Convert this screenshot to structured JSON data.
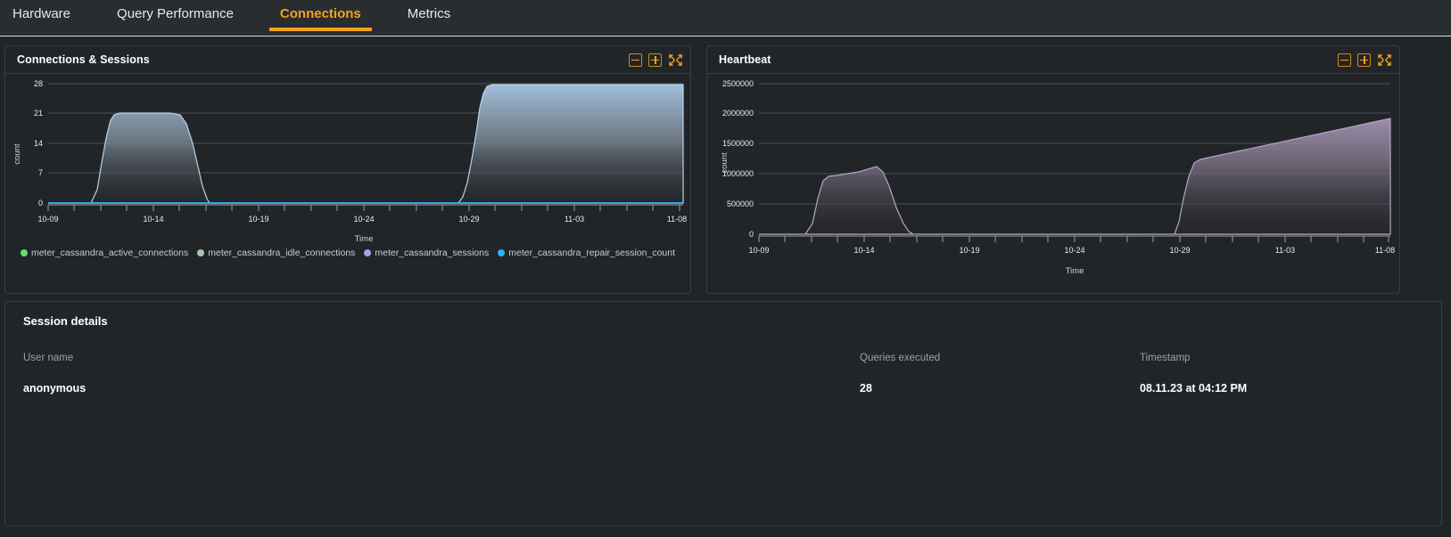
{
  "tabs": [
    {
      "label": "Hardware",
      "active": false
    },
    {
      "label": "Query Performance",
      "active": false
    },
    {
      "label": "Connections",
      "active": true
    },
    {
      "label": "Metrics",
      "active": false
    }
  ],
  "panels": {
    "connections": {
      "title": "Connections & Sessions",
      "tools": {
        "collapse_label": "−",
        "expand_label": "+",
        "fullscreen_label": "fullscreen"
      }
    },
    "heartbeat": {
      "title": "Heartbeat",
      "tools": {
        "collapse_label": "−",
        "expand_label": "+",
        "fullscreen_label": "fullscreen"
      }
    }
  },
  "colors": {
    "accent": "#f5a11b",
    "panel_bg": "#222528",
    "page_bg": "#222528",
    "tabbar_bg": "#2a2d30",
    "border": "#3a3e42",
    "active_connections": "#62e06b",
    "idle_connections": "#a8c5b4",
    "sessions": "#9aa7e0",
    "repair_session_count": "#29b6f6",
    "heartbeat_series": "#a08cb0"
  },
  "chart_data": [
    {
      "type": "area",
      "title": "Connections & Sessions",
      "xlabel": "Time",
      "ylabel": "count",
      "ylim": [
        0,
        28
      ],
      "yticks": [
        0,
        7,
        14,
        21,
        28
      ],
      "xticks": [
        "10-09",
        "10-14",
        "10-19",
        "10-24",
        "10-29",
        "11-03",
        "11-08"
      ],
      "grid": true,
      "legend_position": "bottom",
      "legend": [
        {
          "name": "meter_cassandra_active_connections",
          "color": "#62e06b"
        },
        {
          "name": "meter_cassandra_idle_connections",
          "color": "#a8c5b4"
        },
        {
          "name": "meter_cassandra_sessions",
          "color": "#9aa7e0"
        },
        {
          "name": "meter_cassandra_repair_session_count",
          "color": "#29b6f6"
        }
      ],
      "series": [
        {
          "name": "meter_cassandra_sessions",
          "color": "#9aa7e0",
          "x": [
            "10-09",
            "10-10",
            "10-11",
            "10-12",
            "10-13",
            "10-14",
            "10-15",
            "10-16",
            "10-17",
            "10-18",
            "10-19",
            "10-20",
            "10-21",
            "10-22",
            "10-23",
            "10-24",
            "10-25",
            "10-26",
            "10-27",
            "10-28",
            "10-29",
            "10-30",
            "10-31",
            "11-01",
            "11-02",
            "11-03",
            "11-04",
            "11-05",
            "11-06",
            "11-07",
            "11-08"
          ],
          "values": [
            0,
            0,
            14,
            21,
            21,
            21,
            21,
            20,
            12,
            2,
            0,
            0,
            0,
            0,
            0,
            0,
            0,
            0,
            0,
            0,
            12,
            27,
            28,
            28,
            28,
            28,
            28,
            28,
            28,
            28,
            28
          ]
        },
        {
          "name": "meter_cassandra_repair_session_count",
          "color": "#29b6f6",
          "values_note": "flat at zero across whole range",
          "values": [
            0,
            0,
            0,
            0,
            0,
            0,
            0,
            0,
            0,
            0,
            0,
            0,
            0,
            0,
            0,
            0,
            0,
            0,
            0,
            0,
            0,
            0,
            0,
            0,
            0,
            0,
            0,
            0,
            0,
            0,
            0
          ]
        },
        {
          "name": "meter_cassandra_active_connections",
          "color": "#62e06b",
          "values": [
            0,
            0,
            0,
            0,
            0,
            0,
            0,
            0,
            0,
            0,
            0,
            0,
            0,
            0,
            0,
            0,
            0,
            0,
            0,
            0,
            0,
            0,
            0,
            0,
            0,
            0,
            0,
            0,
            0,
            0,
            0
          ]
        },
        {
          "name": "meter_cassandra_idle_connections",
          "color": "#a8c5b4",
          "values": [
            0,
            0,
            0,
            0,
            0,
            0,
            0,
            0,
            0,
            0,
            0,
            0,
            0,
            0,
            0,
            0,
            0,
            0,
            0,
            0,
            0,
            0,
            0,
            0,
            0,
            0,
            0,
            0,
            0,
            0,
            0
          ]
        }
      ]
    },
    {
      "type": "area",
      "title": "Heartbeat",
      "xlabel": "Time",
      "ylabel": "count",
      "ylim": [
        0,
        2500000
      ],
      "yticks": [
        0,
        500000,
        1000000,
        1500000,
        2000000,
        2500000
      ],
      "xticks": [
        "10-09",
        "10-14",
        "10-19",
        "10-24",
        "10-29",
        "11-03",
        "11-08"
      ],
      "grid": true,
      "legend_position": "none",
      "series": [
        {
          "name": "heartbeat",
          "color": "#a08cb0",
          "x": [
            "10-09",
            "10-10",
            "10-11",
            "10-12",
            "10-13",
            "10-14",
            "10-15",
            "10-16",
            "10-17",
            "10-18",
            "10-19",
            "10-20",
            "10-21",
            "10-22",
            "10-23",
            "10-24",
            "10-25",
            "10-26",
            "10-27",
            "10-28",
            "10-29",
            "10-30",
            "10-31",
            "11-01",
            "11-02",
            "11-03",
            "11-04",
            "11-05",
            "11-06",
            "11-07",
            "11-08"
          ],
          "values": [
            0,
            0,
            300000,
            880000,
            930000,
            980000,
            1060000,
            1000000,
            600000,
            120000,
            0,
            0,
            0,
            0,
            0,
            0,
            0,
            0,
            0,
            0,
            560000,
            1210000,
            1280000,
            1360000,
            1440000,
            1530000,
            1620000,
            1700000,
            1780000,
            1860000,
            1930000
          ]
        }
      ]
    }
  ],
  "session_details": {
    "title": "Session details",
    "columns": [
      "User name",
      "Queries executed",
      "Timestamp"
    ],
    "rows": [
      {
        "user_name": "anonymous",
        "queries_executed": "28",
        "timestamp": "08.11.23 at 04:12 PM"
      }
    ]
  }
}
